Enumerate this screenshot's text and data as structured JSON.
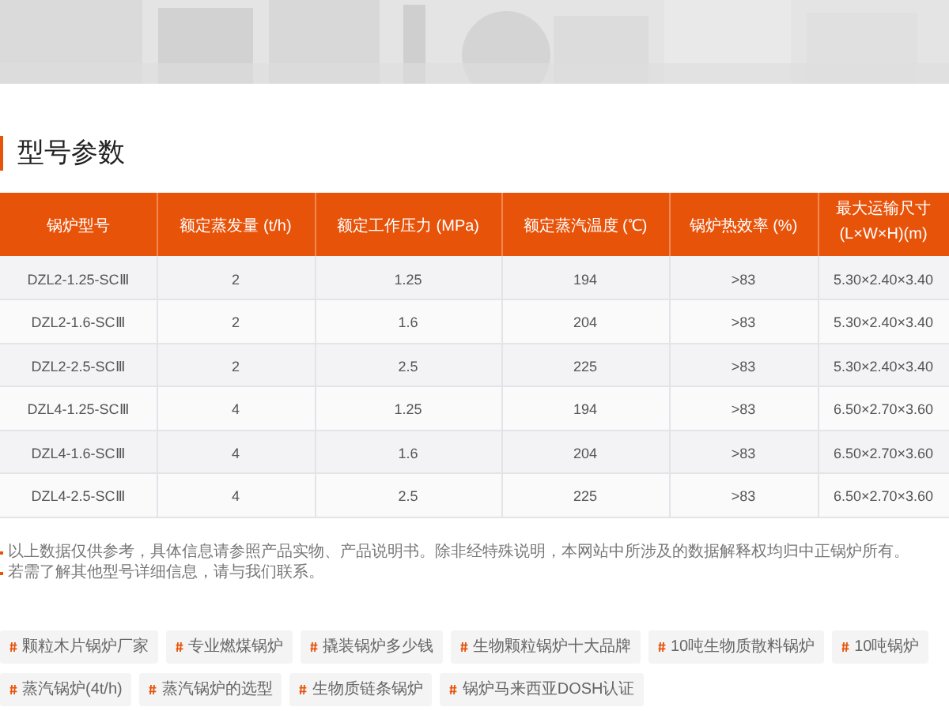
{
  "section_title": "型号参数",
  "table": {
    "columns": [
      "锅炉型号",
      "额定蒸发量 (t/h)",
      "额定工作压力 (MPa)",
      "额定蒸汽温度 (℃)",
      "锅炉热效率 (%)",
      "最大运输尺寸(L×W×H)(m)"
    ],
    "rows": [
      [
        "DZL2-1.25-SCⅢ",
        "2",
        "1.25",
        "194",
        ">83",
        "5.30×2.40×3.40"
      ],
      [
        "DZL2-1.6-SCⅢ",
        "2",
        "1.6",
        "204",
        ">83",
        "5.30×2.40×3.40"
      ],
      [
        "DZL2-2.5-SCⅢ",
        "2",
        "2.5",
        "225",
        ">83",
        "5.30×2.40×3.40"
      ],
      [
        "DZL4-1.25-SCⅢ",
        "4",
        "1.25",
        "194",
        ">83",
        "6.50×2.70×3.60"
      ],
      [
        "DZL4-1.6-SCⅢ",
        "4",
        "1.6",
        "204",
        ">83",
        "6.50×2.70×3.60"
      ],
      [
        "DZL4-2.5-SCⅢ",
        "4",
        "2.5",
        "225",
        ">83",
        "6.50×2.70×3.60"
      ]
    ]
  },
  "notes": [
    "以上数据仅供参考，具体信息请参照产品实物、产品说明书。除非经特殊说明，本网站中所涉及的数据解释权均归中正锅炉所有。",
    "若需了解其他型号详细信息，请与我们联系。"
  ],
  "tags": [
    "颗粒木片锅炉厂家",
    "专业燃煤锅炉",
    "撬装锅炉多少钱",
    "生物颗粒锅炉十大品牌",
    "10吨生物质散料锅炉",
    "10吨锅炉",
    "蒸汽锅炉(4t/h)",
    "蒸汽锅炉的选型",
    "生物质链条锅炉",
    "锅炉马来西亚DOSH认证"
  ]
}
